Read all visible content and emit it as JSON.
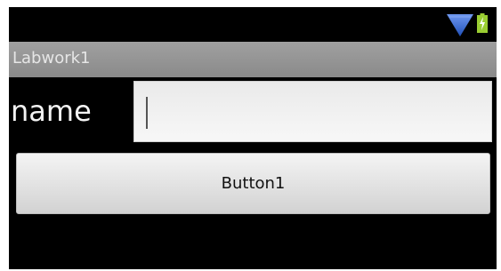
{
  "app": {
    "title": "Labwork1"
  },
  "status_bar": {
    "icons": [
      "wifi-icon",
      "battery-charging-icon"
    ],
    "colors": {
      "wifi": "#3f6fd0",
      "battery": "#9acd32"
    }
  },
  "form": {
    "name_label": "name",
    "name_value": "",
    "button_label": "Button1"
  }
}
